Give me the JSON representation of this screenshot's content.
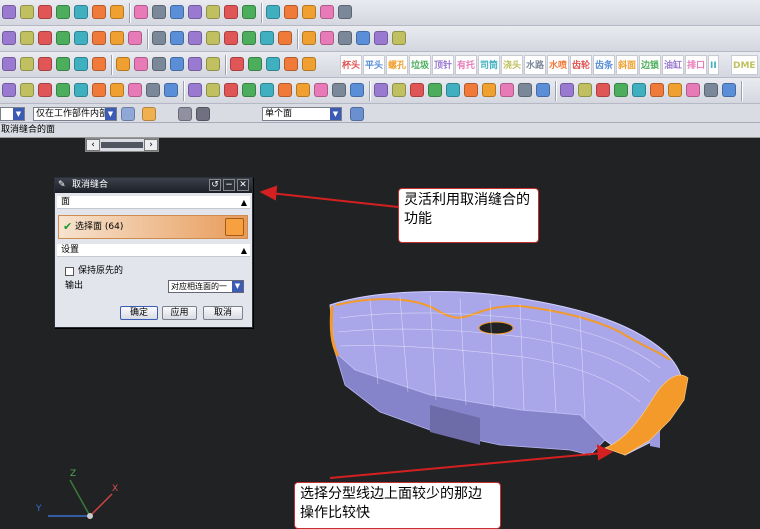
{
  "toolbar_cn_buttons": [
    "杯头",
    "平头",
    "螺孔",
    "垃圾",
    "顶针",
    "有托",
    "司筒",
    "浇头",
    "水路",
    "水喷",
    "齿轮",
    "齿条",
    "斜面",
    "边锁",
    "油缸",
    "排口",
    "II",
    "DME"
  ],
  "selection_bar": {
    "filter_value": "仅在工作部件内部",
    "face_rule_value": "单个面"
  },
  "cue_line": "取消缝合的面",
  "dialog": {
    "title": "取消缝合",
    "section_face": "面",
    "select_face_label": "选择面 (64)",
    "section_settings": "设置",
    "keep_original_label": "保持原先的",
    "output_label": "输出",
    "output_value": "对应相连面的一",
    "ok_label": "确定",
    "apply_label": "应用",
    "cancel_label": "取消"
  },
  "annotations": {
    "top_note": "灵活利用取消缝合的功能",
    "bottom_note": "选择分型线边上面较少的那边操作比较快"
  },
  "axis": {
    "x": "X",
    "y": "Y",
    "z": "Z"
  },
  "colors": {
    "viewport": "#202224",
    "highlight": "#f39a2a",
    "part": "#a9a7ea",
    "arrow": "#d42020"
  }
}
